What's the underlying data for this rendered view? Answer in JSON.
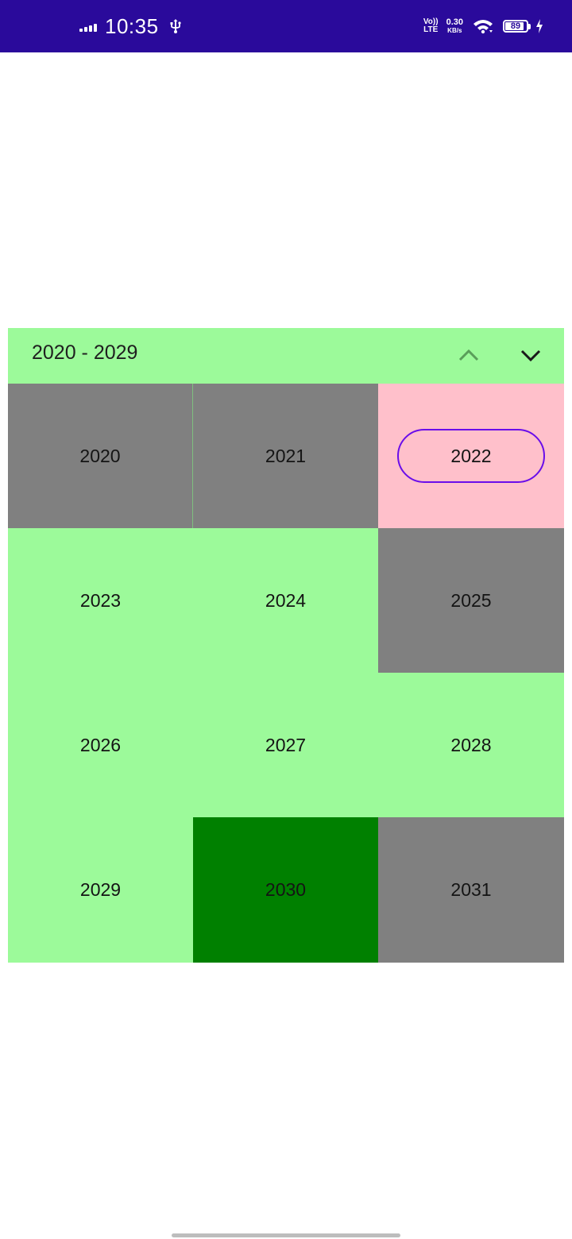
{
  "status_bar": {
    "time": "10:35",
    "volte_top": "Vo))",
    "volte_bottom": "LTE",
    "net_speed_value": "0.30",
    "net_speed_unit": "KB/s",
    "battery_level": "89",
    "background_color": "#2a0a9b",
    "icons": [
      "signal-icon",
      "usb-icon",
      "volte-icon",
      "wifi-icon",
      "battery-icon",
      "charging-icon"
    ]
  },
  "calendar": {
    "decade_label": "2020 - 2029",
    "prev_icon": "chevron-up-icon",
    "next_icon": "chevron-down-icon",
    "selected_year": "2022",
    "years": [
      {
        "label": "2020",
        "style": "gray"
      },
      {
        "label": "2021",
        "style": "gray"
      },
      {
        "label": "2022",
        "style": "pink",
        "selected": true
      },
      {
        "label": "2023",
        "style": "light-green"
      },
      {
        "label": "2024",
        "style": "light-green"
      },
      {
        "label": "2025",
        "style": "gray"
      },
      {
        "label": "2026",
        "style": "light-green"
      },
      {
        "label": "2027",
        "style": "light-green"
      },
      {
        "label": "2028",
        "style": "light-green"
      },
      {
        "label": "2029",
        "style": "light-green"
      },
      {
        "label": "2030",
        "style": "green"
      },
      {
        "label": "2031",
        "style": "gray"
      }
    ],
    "colors": {
      "header_bg": "#9cfa9a",
      "gray": "#808080",
      "light_green": "#9cfa9a",
      "pink": "#ffc0cb",
      "green": "#008000",
      "selection_border": "#6a0dea"
    }
  }
}
